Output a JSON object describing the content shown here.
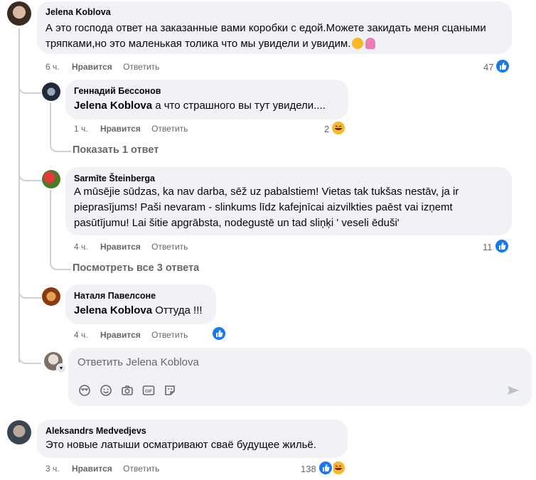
{
  "comments": [
    {
      "author": "Jelena Koblova",
      "text": "А это господа ответ на заказанные вами коробки с едой.Можете закидать меня сцаными тряпками,но это маленькая толика что мы увидели и увидим.",
      "time": "6 ч.",
      "like": "Нравится",
      "reply": "Ответить",
      "reactions": "47",
      "replies": [
        {
          "author": "Геннадий Бессонов",
          "mention": "Jelena Koblova",
          "text": " а что страшного вы тут увидели....",
          "time": "1 ч.",
          "like": "Нравится",
          "reply": "Ответить",
          "reactions": "2",
          "more": "Показать 1 ответ"
        },
        {
          "author": "Sarmīte Šteinberga",
          "text": "A mūsējie sūdzas, ka nav darba, sēž uz pabalstiem! Vietas tak tukšas nestāv, ja ir pieprasījums! Paši nevaram - slinkums līdz kafejnīcai aizvilkties paēst vai izņemt pasūtījumu! Lai šitie apgrābsta, nodegustē un tad sliņķi ' veseli ēduši'",
          "time": "4 ч.",
          "like": "Нравится",
          "reply": "Ответить",
          "reactions": "11",
          "more": "Посмотреть все 3 ответа"
        },
        {
          "author": "Наталя Павелсоне",
          "mention": "Jelena Koblova",
          "text": " Оттуда !!!",
          "time": "4 ч.",
          "like": "Нравится",
          "reply": "Ответить"
        }
      ],
      "reply_box": {
        "placeholder": "Ответить Jelena Koblova"
      }
    },
    {
      "author": "Aleksandrs Medvedjevs",
      "text": "Это новые латыши осматривают сваё будущее жильё.",
      "time": "3 ч.",
      "like": "Нравится",
      "reply": "Ответить",
      "reactions": "138"
    }
  ],
  "colors": {
    "like_blue": "#1877f2",
    "bubble_bg": "#f0f2f5",
    "meta_gray": "#65676b",
    "haha_yellow": "#f7b928"
  },
  "icons": [
    "smile-emoji-icon",
    "woman-gesture-emoji-icon",
    "like-reaction-icon",
    "haha-reaction-icon",
    "avatar-icon",
    "emoji-icon",
    "camera-icon",
    "gif-icon",
    "sticker-icon",
    "send-icon"
  ]
}
